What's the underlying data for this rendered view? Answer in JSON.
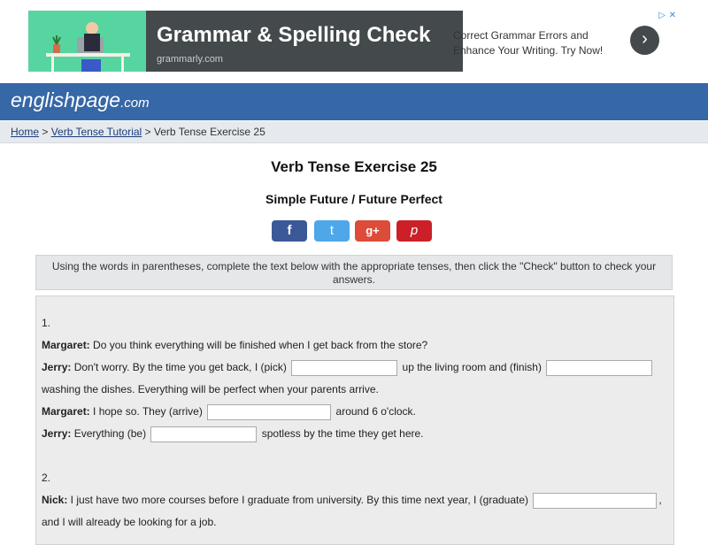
{
  "ad": {
    "headline": "Grammar & Spelling Check",
    "domain": "grammarly.com",
    "copy": "Correct Grammar Errors and Enhance Your Writing. Try Now!",
    "arrow": "›",
    "close_icon": "✕",
    "info_icon": "▷"
  },
  "site": {
    "logo_main": "englishpage",
    "logo_tld": ".com"
  },
  "breadcrumb": {
    "home": "Home",
    "sep1": " > ",
    "tutorial": "Verb Tense Tutorial",
    "sep2": " > ",
    "current": "Verb Tense Exercise 25"
  },
  "page": {
    "title": "Verb Tense Exercise 25",
    "subtitle": "Simple Future / Future Perfect"
  },
  "share": {
    "facebook": "f",
    "twitter": "t",
    "googleplus": "g+",
    "pinterest": "p"
  },
  "instructions": "Using the words in parentheses, complete the text below with the appropriate tenses, then click the \"Check\" button to check your answers.",
  "exercise": {
    "q1_num": "1.",
    "q1_l1_speaker": "Margaret:",
    "q1_l1_text": " Do you think everything will be finished when I get back from the store?",
    "q1_l2_speaker": "Jerry:",
    "q1_l2_a": " Don't worry. By the time you get back, I (pick) ",
    "q1_l2_b": " up the living room and (finish) ",
    "q1_l3": "washing the dishes. Everything will be perfect when your parents arrive.",
    "q1_l4_speaker": "Margaret:",
    "q1_l4_a": " I hope so. They (arrive) ",
    "q1_l4_b": " around 6 o'clock.",
    "q1_l5_speaker": "Jerry:",
    "q1_l5_a": " Everything (be) ",
    "q1_l5_b": " spotless by the time they get here.",
    "q2_num": "2.",
    "q2_l1_speaker": "Nick:",
    "q2_l1_a": " I just have two more courses before I graduate from university. By this time next year, I (graduate) ",
    "q2_l1_b": ",",
    "q2_l2": "and I will already be looking for a job."
  }
}
